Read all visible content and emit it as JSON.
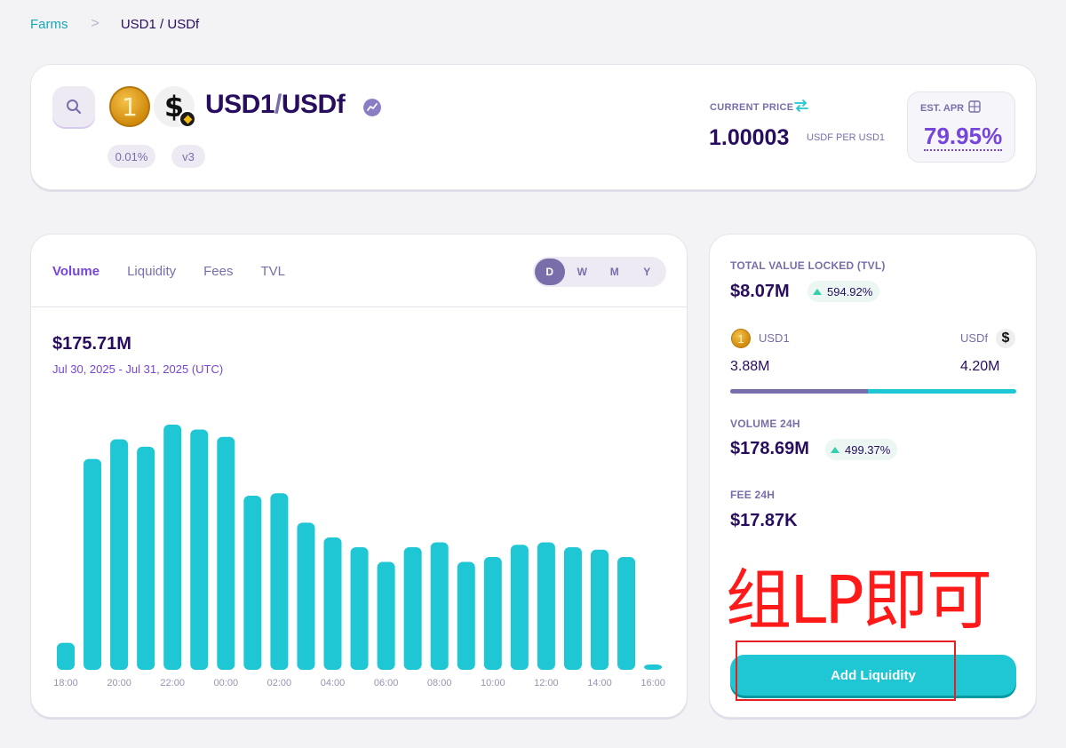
{
  "breadcrumb": {
    "link": "Farms",
    "separator": ">",
    "current": "USD1 / USDf"
  },
  "pair": {
    "token0": "USD1",
    "separator": "/",
    "token1": "USDf",
    "token0_glyph": "1",
    "token1_glyph": "$",
    "fee_tier": "0.01%",
    "version": "v3"
  },
  "price": {
    "label": "CURRENT PRICE",
    "value": "1.00003",
    "unit": "USDF PER USD1"
  },
  "apr": {
    "label": "EST. APR",
    "value": "79.95%"
  },
  "chart": {
    "tabs": [
      "Volume",
      "Liquidity",
      "Fees",
      "TVL"
    ],
    "active_tab": "Volume",
    "periods": [
      "D",
      "W",
      "M",
      "Y"
    ],
    "active_period": "D",
    "total": "$175.71M",
    "range": "Jul 30, 2025 - Jul 31, 2025 (UTC)",
    "colors": {
      "bar": "#1fc7d4"
    }
  },
  "chart_data": {
    "type": "bar",
    "categories": [
      "18:00",
      "19:00",
      "20:00",
      "21:00",
      "22:00",
      "23:00",
      "00:00",
      "01:00",
      "02:00",
      "03:00",
      "04:00",
      "05:00",
      "06:00",
      "07:00",
      "08:00",
      "09:00",
      "10:00",
      "11:00",
      "12:00",
      "13:00",
      "14:00",
      "15:00",
      "16:00"
    ],
    "tick_labels": [
      "18:00",
      "20:00",
      "22:00",
      "00:00",
      "02:00",
      "04:00",
      "06:00",
      "08:00",
      "10:00",
      "12:00",
      "14:00",
      "16:00"
    ],
    "values": [
      1.1,
      8.6,
      9.4,
      9.1,
      10.0,
      9.8,
      9.5,
      7.1,
      7.2,
      6.0,
      5.4,
      5.0,
      4.4,
      5.0,
      5.2,
      4.4,
      4.6,
      5.1,
      5.2,
      5.0,
      4.9,
      4.6,
      0.2
    ],
    "title": "",
    "xlabel": "",
    "ylabel": "",
    "grid": false
  },
  "stats": {
    "tvl_label": "TOTAL VALUE LOCKED (TVL)",
    "tvl_value": "$8.07M",
    "tvl_change": "594.92%",
    "token0_name": "USD1",
    "token1_name": "USDf",
    "token0_amount": "3.88M",
    "token1_amount": "4.20M",
    "token0_share": 0.48,
    "volume_label": "VOLUME 24H",
    "volume_value": "$178.69M",
    "volume_change": "499.37%",
    "fee_label": "FEE 24H",
    "fee_value": "$17.87K",
    "add_liquidity": "Add Liquidity"
  },
  "annotation": {
    "text": "组LP即可",
    "color": "#ff1a1a"
  }
}
